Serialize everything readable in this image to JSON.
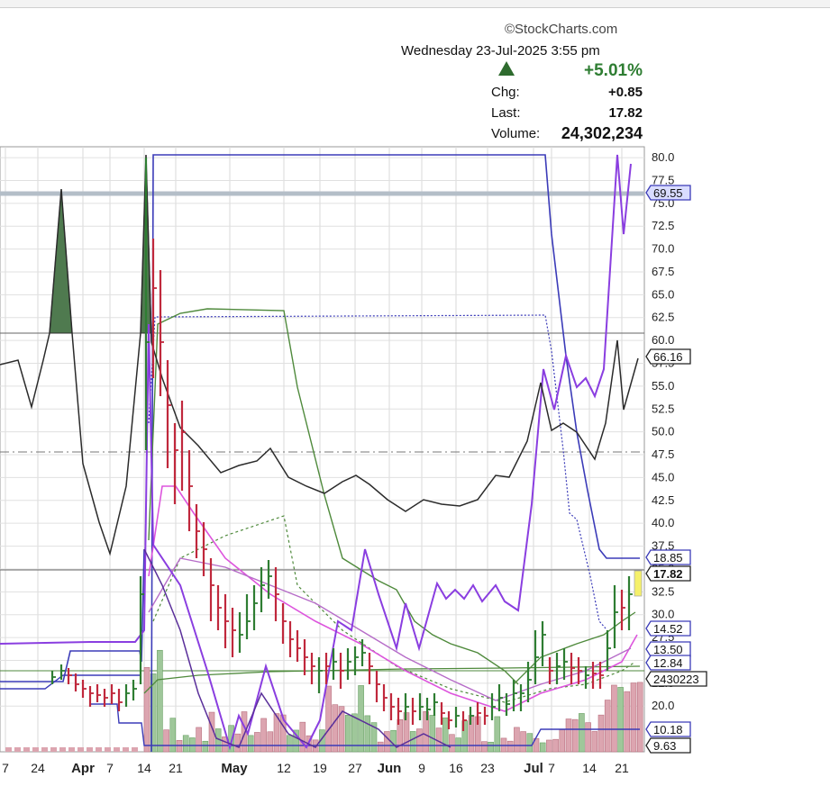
{
  "header": {
    "logo": "©StockCharts.com",
    "datetime": "Wednesday  23-Jul-2025  3:55 pm",
    "pct_change": "+5.01%",
    "chg_label": "Chg:",
    "chg_value": "+0.85",
    "last_label": "Last:",
    "last_value": "17.82",
    "volume_label": "Volume:",
    "volume_value": "24,302,234"
  },
  "chart_data": {
    "type": "line",
    "x_tick_labels": [
      "7",
      "24",
      "Apr",
      "7",
      "14",
      "21",
      "May",
      "12",
      "19",
      "27",
      "Jun",
      "9",
      "16",
      "23",
      "Jul",
      "7",
      "14",
      "21"
    ],
    "y_ticks": [
      20.0,
      22.5,
      25.0,
      27.5,
      30.0,
      32.5,
      35.0,
      37.5,
      40.0,
      42.5,
      45.0,
      47.5,
      50.0,
      52.5,
      55.0,
      57.5,
      60.0,
      62.5,
      65.0,
      67.5,
      70.0,
      72.5,
      75.0,
      77.5,
      80.0
    ],
    "y_tick_labels": [
      "20.0",
      "22.5",
      "25.0",
      "27.5",
      "30.0",
      "32.5",
      "35.0",
      "37.5",
      "40.0",
      "42.5",
      "45.0",
      "47.5",
      "50.0",
      "52.5",
      "55.0",
      "57.5",
      "60.0",
      "62.5",
      "65.0",
      "67.5",
      "70.0",
      "72.5",
      "75.0",
      "77.5",
      "80.0"
    ],
    "ylim": [
      15,
      80.5
    ],
    "grid": true,
    "price_tags": [
      {
        "label": "69.55",
        "value": 69.55,
        "color": "#3b3bb8",
        "fill": "#d9dcff"
      },
      {
        "label": "66.16",
        "value": 38.6,
        "color": "#222",
        "fill": "#ffffff"
      },
      {
        "label": "18.85",
        "value": 18.85,
        "color": "#3b3bb8",
        "fill": "#ffffff"
      },
      {
        "label": "17.82",
        "value": 17.82,
        "color": "#222",
        "fill": "#ffffff"
      },
      {
        "label": "14.52",
        "value": 14.52,
        "color": "#3b3bb8",
        "fill": "#ffffff"
      },
      {
        "label": "13.50",
        "value": 13.5,
        "color": "#3b3bb8",
        "fill": "#ffffff"
      },
      {
        "label": "12.84",
        "value": 12.84,
        "color": "#3b3bb8",
        "fill": "#ffffff"
      },
      {
        "label": "2430223",
        "value": 10.6,
        "color": "#222",
        "fill": "#ffffff"
      },
      {
        "label": "10.18",
        "value": 10.18,
        "color": "#3b3bb8",
        "fill": "#ffffff"
      },
      {
        "label": "9.63",
        "value": 9.63,
        "color": "#222",
        "fill": "#ffffff"
      }
    ],
    "colors": {
      "up": "#2e7d32",
      "down": "#c0283c",
      "upper_band": "#3b3bb8",
      "momentum": "#8a3ee0",
      "rsi": "#2b2b2b",
      "ma_light": "#dd55dd",
      "ma_green": "#4f8a3c"
    }
  }
}
